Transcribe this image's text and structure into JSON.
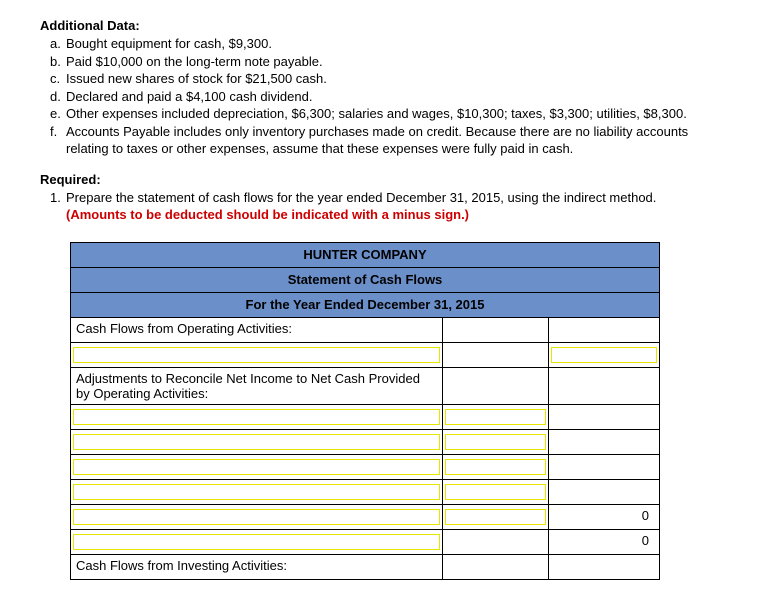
{
  "additional": {
    "title": "Additional Data:",
    "items": [
      {
        "letter": "a.",
        "text": "Bought equipment for cash, $9,300."
      },
      {
        "letter": "b.",
        "text": "Paid $10,000 on the long-term note payable."
      },
      {
        "letter": "c.",
        "text": "Issued new shares of stock for $21,500 cash."
      },
      {
        "letter": "d.",
        "text": "Declared and paid a $4,100 cash dividend."
      },
      {
        "letter": "e.",
        "text": "Other expenses included depreciation, $6,300; salaries and wages, $10,300; taxes, $3,300; utilities, $8,300."
      },
      {
        "letter": "f.",
        "text": "Accounts Payable includes only inventory purchases made on credit. Because there are no liability accounts relating to taxes or other expenses, assume that these expenses were fully paid in cash."
      }
    ]
  },
  "required": {
    "title": "Required:",
    "num": "1.",
    "text": "Prepare the statement of cash flows for the year ended December 31, 2015, using the indirect method.",
    "note": "(Amounts to be deducted should be indicated with a minus sign.)"
  },
  "table": {
    "company": "HUNTER COMPANY",
    "statement": "Statement of Cash Flows",
    "period": "For the Year Ended December 31, 2015",
    "row_operating": "Cash Flows from Operating Activities:",
    "row_adjustments": "Adjustments to Reconcile Net Income to Net Cash Provided by Operating Activities:",
    "row_investing": "Cash Flows from Investing Activities:",
    "zero1": "0",
    "zero2": "0"
  }
}
